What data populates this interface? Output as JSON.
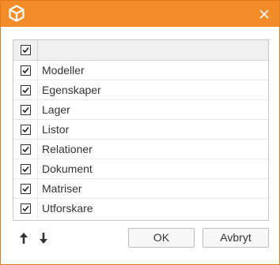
{
  "dialog": {
    "ok_label": "OK",
    "cancel_label": "Avbryt"
  },
  "list": {
    "header_checked": true,
    "items": [
      {
        "label": "Modeller",
        "checked": true
      },
      {
        "label": "Egenskaper",
        "checked": true
      },
      {
        "label": "Lager",
        "checked": true
      },
      {
        "label": "Listor",
        "checked": true
      },
      {
        "label": "Relationer",
        "checked": true
      },
      {
        "label": "Dokument",
        "checked": true
      },
      {
        "label": "Matriser",
        "checked": true
      },
      {
        "label": "Utforskare",
        "checked": true
      }
    ]
  },
  "icons": {
    "logo": "cube-logo-icon",
    "close": "close-icon",
    "move_up": "arrow-up-icon",
    "move_down": "arrow-down-icon",
    "checkbox": "checkmark-icon"
  },
  "colors": {
    "titlebar": "#f28c28",
    "border": "#e07a22"
  }
}
